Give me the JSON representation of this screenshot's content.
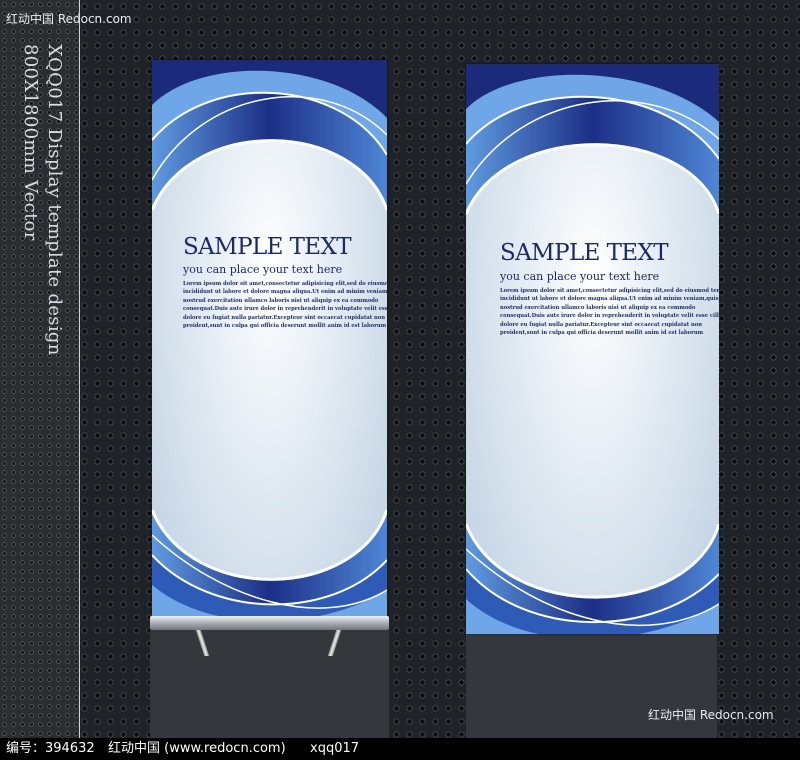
{
  "watermarks": {
    "top": "红动中国 Redocn.com",
    "bottom": "红动中国 Redocn.com"
  },
  "caption": {
    "line1": "XQQ017 Display template design",
    "line2": "800X1800mm Vector"
  },
  "banners": [
    {
      "title": "SAMPLE TEXT",
      "subtitle": "you can place your text here",
      "body": [
        "Lorem ipsum dolor sit amet,consectetur adipisicing elit,sed do eiusmod tempor",
        "incididunt ut labore et dolore magna aliqua.Ut enim ad minim veniam,quis",
        "nostrud exercitation ullamco laboris nisi ut aliquip ex ea commodo",
        "consequat.Duis aute irure dolor in reprehenderit in voluptate velit esse cillum",
        "dolore eu fugiat nulla pariatur.Excepteur sint occaecat cupidatat non",
        "proident,sunt in culpa qui officia deserunt mollit anim id est laborum"
      ]
    },
    {
      "title": "SAMPLE TEXT",
      "subtitle": "you can place your text here",
      "body": [
        "Lorem ipsum dolor sit amet,consectetur adipisicing elit,sed do eiusmod tempor",
        "incididunt ut labore et dolore magna aliqua.Ut enim ad minim veniam,quis",
        "nostrud exercitation ullamco laboris nisi ut aliquip ex ea commodo",
        "consequat.Duis aute irure dolor in reprehenderit in voluptate velit esse cillum",
        "dolore eu fugiat nulla pariatur.Excepteur sint occaecat cupidatat non",
        "proident,sunt in culpa qui officia deserunt mollit anim id est laborum"
      ]
    }
  ],
  "footer": {
    "id_label": "编号：394632",
    "site": "红动中国 (www.redocn.com)",
    "code": "xqq017"
  },
  "colors": {
    "wave_dark": "#1b2a7a",
    "wave_mid": "#2f5bb8",
    "wave_light": "#6fa6e8",
    "title": "#1b2a66"
  }
}
